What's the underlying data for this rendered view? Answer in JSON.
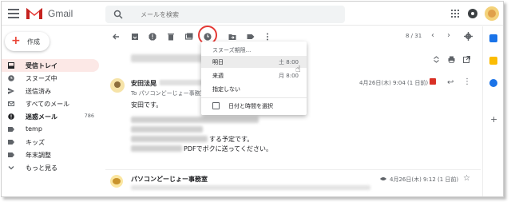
{
  "app": {
    "name": "Gmail"
  },
  "search": {
    "placeholder": "メールを検索"
  },
  "compose": {
    "label": "作成"
  },
  "sidebar": {
    "items": [
      {
        "label": "受信トレイ",
        "icon": "inbox-icon"
      },
      {
        "label": "スヌーズ中",
        "icon": "clock-icon"
      },
      {
        "label": "送信済み",
        "icon": "send-icon"
      },
      {
        "label": "すべてのメール",
        "icon": "mail-icon"
      },
      {
        "label": "迷惑メール",
        "icon": "spam-icon",
        "count": "786"
      },
      {
        "label": "temp",
        "icon": "label-icon"
      },
      {
        "label": "キッズ",
        "icon": "label-icon"
      },
      {
        "label": "年末調整",
        "icon": "label-icon"
      },
      {
        "label": "もっと見る",
        "icon": "chevron-down-icon"
      }
    ]
  },
  "toolbar": {
    "pager": "8 / 31"
  },
  "message1": {
    "sender": "安田法晃",
    "to": "To パソコンどーじょー事務室",
    "date": "4月26日(木) 9:04 (1 日前)",
    "greeting": "安田です。",
    "line3": "する予定です。",
    "line4": "PDFでボクに送ってください。"
  },
  "message2": {
    "sender": "パソコンどーじょー事務室",
    "date": "4月26日(木) 9:12 (1 日前)"
  },
  "snooze_menu": {
    "title": "スヌーズ期限...",
    "options": [
      {
        "label": "明日",
        "time": "土 8:00"
      },
      {
        "label": "来週",
        "time": "月 8:00"
      },
      {
        "label": "指定しない",
        "time": ""
      }
    ],
    "pick": "日付と時間を選択"
  },
  "colors": {
    "accent": "#d93025",
    "active_bg": "#fce8e6",
    "snooze_highlight": "#e53935"
  }
}
